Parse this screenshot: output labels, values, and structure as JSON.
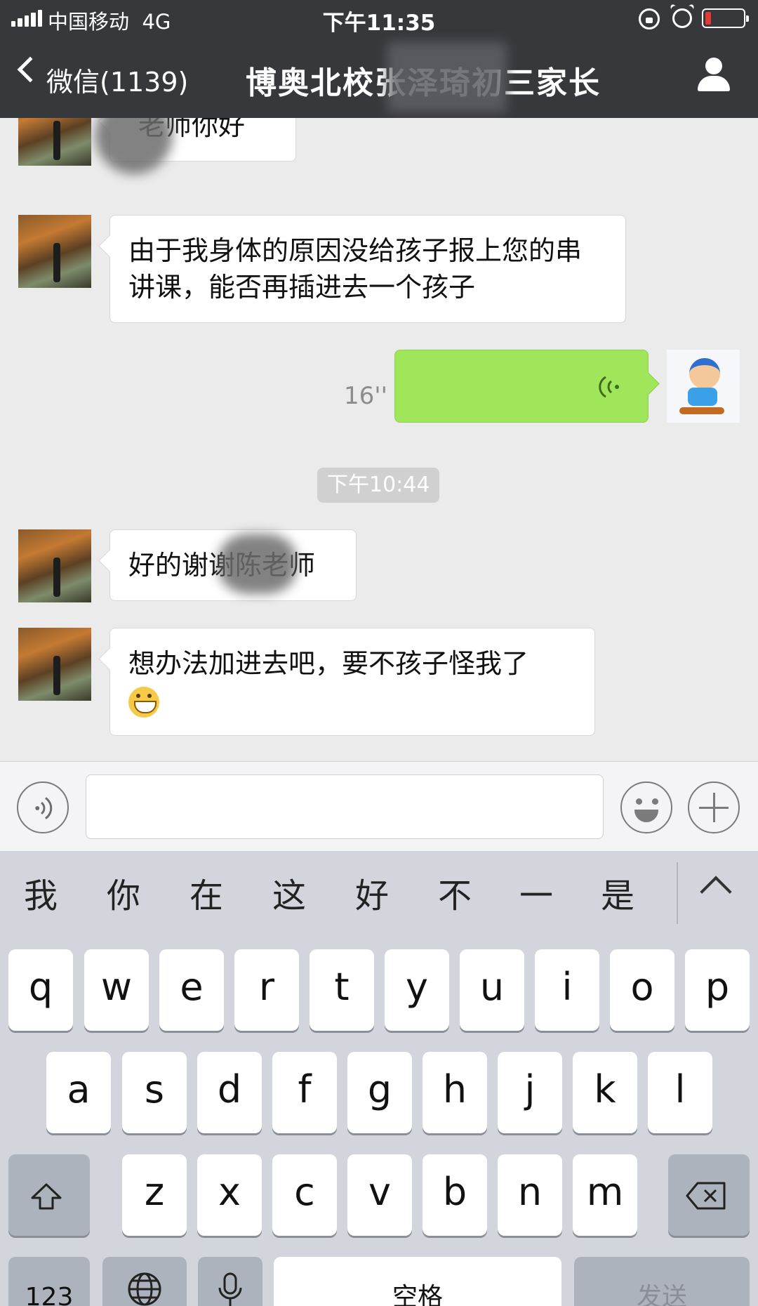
{
  "status_bar": {
    "carrier": "中国移动",
    "network": "4G",
    "time": "下午11:35",
    "battery_level": 0.15
  },
  "nav": {
    "back_label": "微信(1139)",
    "title": "博奥北校张泽琦初三家长"
  },
  "messages": [
    {
      "text": "老师你好"
    },
    {
      "text": "由于我身体的原因没给孩子报上您的串讲课，能否再插进去一个孩子"
    },
    {
      "voice_duration": "16''"
    },
    {
      "timestamp": "下午10:44"
    },
    {
      "text": "好的谢谢陈老师"
    },
    {
      "text": "想办法加进去吧，要不孩子怪我了",
      "emoji": "grinning-face"
    }
  ],
  "icons": {
    "voice": "voice-icon",
    "emoji": "emoji-icon",
    "plus": "plus-icon",
    "person": "person-icon"
  },
  "keyboard": {
    "candidates": [
      "我",
      "你",
      "在",
      "这",
      "好",
      "不",
      "一",
      "是"
    ],
    "row1": [
      "q",
      "w",
      "e",
      "r",
      "t",
      "y",
      "u",
      "i",
      "o",
      "p"
    ],
    "row2": [
      "a",
      "s",
      "d",
      "f",
      "g",
      "h",
      "j",
      "k",
      "l"
    ],
    "row3": [
      "z",
      "x",
      "c",
      "v",
      "b",
      "n",
      "m"
    ],
    "numbers_label": "123",
    "space_label": "空格",
    "send_label": "发送"
  },
  "colors": {
    "nav_bg": "#37383c",
    "chat_bg": "#ebebeb",
    "my_bubble": "#a0e65a",
    "battery_low": "#e53935"
  }
}
